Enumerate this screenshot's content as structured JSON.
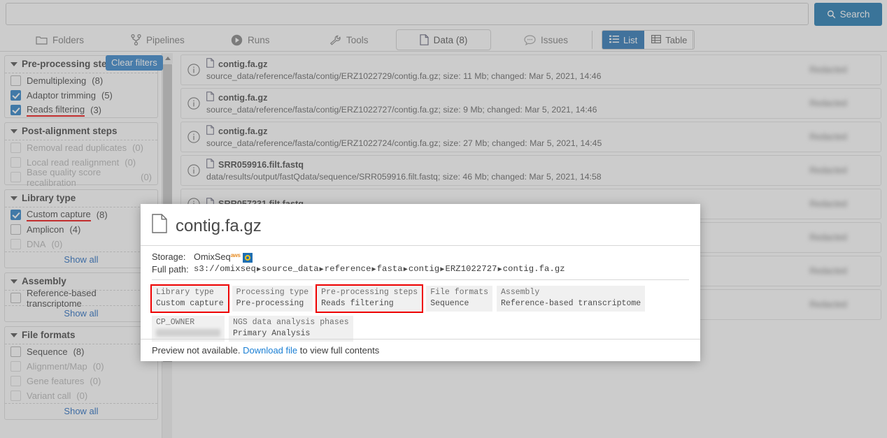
{
  "search": {
    "value": "",
    "placeholder": "",
    "button_label": "Search"
  },
  "tabs": [
    {
      "label": "Folders",
      "icon": "folder-icon",
      "active": false
    },
    {
      "label": "Pipelines",
      "icon": "pipeline-icon",
      "active": false
    },
    {
      "label": "Runs",
      "icon": "play-icon",
      "active": false
    },
    {
      "label": "Tools",
      "icon": "wrench-icon",
      "active": false
    },
    {
      "label": "Data (8)",
      "icon": "file-icon",
      "active": true
    },
    {
      "label": "Issues",
      "icon": "comment-icon",
      "active": false
    }
  ],
  "view_toggle": {
    "list_label": "List",
    "table_label": "Table",
    "selected": "List"
  },
  "sidebar": {
    "clear_filters_label": "Clear filters",
    "show_all_label": "Show all",
    "facets": [
      {
        "title": "Pre-processing steps",
        "show_all": false,
        "options": [
          {
            "label": "Demultiplexing",
            "count": "(8)",
            "checked": false,
            "disabled": false,
            "highlight": false
          },
          {
            "label": "Adaptor trimming",
            "count": "(5)",
            "checked": true,
            "disabled": false,
            "highlight": false
          },
          {
            "label": "Reads filtering",
            "count": "(3)",
            "checked": true,
            "disabled": false,
            "highlight": true
          }
        ]
      },
      {
        "title": "Post-alignment steps",
        "show_all": false,
        "options": [
          {
            "label": "Removal read duplicates",
            "count": "(0)",
            "checked": false,
            "disabled": true,
            "highlight": false
          },
          {
            "label": "Local read realignment",
            "count": "(0)",
            "checked": false,
            "disabled": true,
            "highlight": false
          },
          {
            "label": "Base quality score recalibration",
            "count": "(0)",
            "checked": false,
            "disabled": true,
            "highlight": false
          }
        ]
      },
      {
        "title": "Library type",
        "show_all": true,
        "options": [
          {
            "label": "Custom capture",
            "count": "(8)",
            "checked": true,
            "disabled": false,
            "highlight": true
          },
          {
            "label": "Amplicon",
            "count": "(4)",
            "checked": false,
            "disabled": false,
            "highlight": false
          },
          {
            "label": "DNA",
            "count": "(0)",
            "checked": false,
            "disabled": true,
            "highlight": false
          }
        ]
      },
      {
        "title": "Assembly",
        "show_all": true,
        "options": [
          {
            "label": "Reference-based transcriptome",
            "count": "",
            "checked": false,
            "disabled": false,
            "highlight": false
          }
        ]
      },
      {
        "title": "File formats",
        "show_all": true,
        "options": [
          {
            "label": "Sequence",
            "count": "(8)",
            "checked": false,
            "disabled": false,
            "highlight": false
          },
          {
            "label": "Alignment/Map",
            "count": "(0)",
            "checked": false,
            "disabled": true,
            "highlight": false
          },
          {
            "label": "Gene features",
            "count": "(0)",
            "checked": false,
            "disabled": true,
            "highlight": false
          },
          {
            "label": "Variant call",
            "count": "(0)",
            "checked": false,
            "disabled": true,
            "highlight": false
          }
        ]
      }
    ]
  },
  "files": [
    {
      "name": "contig.fa.gz",
      "details": "source_data/reference/fasta/contig/ERZ1022729/contig.fa.gz;  size: 11 Mb;  changed: Mar 5, 2021, 14:46",
      "action": "Redacted"
    },
    {
      "name": "contig.fa.gz",
      "details": "source_data/reference/fasta/contig/ERZ1022727/contig.fa.gz;  size: 9 Mb;  changed: Mar 5, 2021, 14:46",
      "action": "Redacted"
    },
    {
      "name": "contig.fa.gz",
      "details": "source_data/reference/fasta/contig/ERZ1022724/contig.fa.gz;  size: 27 Mb;  changed: Mar 5, 2021, 14:45",
      "action": "Redacted"
    },
    {
      "name": "SRR059916.filt.fastq",
      "details": "data/results/output/fastQdata/sequence/SRR059916.filt.fastq;  size: 46 Mb;  changed: Mar 5, 2021, 14:58",
      "action": "Redacted"
    },
    {
      "name": "SRR057231.filt.fastq",
      "details": "",
      "action": "Redacted"
    },
    {
      "name": "",
      "details": "",
      "action": "Redacted"
    },
    {
      "name": "",
      "details": "",
      "action": "Redacted"
    },
    {
      "name": "",
      "details": "",
      "action": "Redacted"
    }
  ],
  "modal": {
    "title": "contig.fa.gz",
    "storage_label": "Storage:",
    "storage_value": "OmixSeq",
    "storage_aws": "aws",
    "fullpath_label": "Full path:",
    "fullpath_root": "s3://omixseq",
    "fullpath_parts": [
      "source_data",
      "reference",
      "fasta",
      "contig",
      "ERZ1022727",
      "contig.fa.gz"
    ],
    "tags": [
      {
        "key": "Library type",
        "value": "Custom capture",
        "highlight": true,
        "redacted": false
      },
      {
        "key": "Processing type",
        "value": "Pre-processing",
        "highlight": false,
        "redacted": false
      },
      {
        "key": "Pre-processing steps",
        "value": "Reads filtering",
        "highlight": true,
        "redacted": false
      },
      {
        "key": "File formats",
        "value": "Sequence",
        "highlight": false,
        "redacted": false
      },
      {
        "key": "Assembly",
        "value": "Reference-based transcriptome",
        "highlight": false,
        "redacted": false
      },
      {
        "key": "CP_OWNER",
        "value": "",
        "highlight": false,
        "redacted": true
      },
      {
        "key": "NGS data analysis phases",
        "value": "Primary Analysis",
        "highlight": false,
        "redacted": false
      }
    ],
    "footer_text_before": "Preview not available.",
    "footer_link": "Download file",
    "footer_text_after": "to view full contents"
  },
  "colors": {
    "accent": "#1471ad",
    "toggle_on": "#1f6fb2",
    "highlight": "#ee0000",
    "link": "#1a7fd4"
  }
}
